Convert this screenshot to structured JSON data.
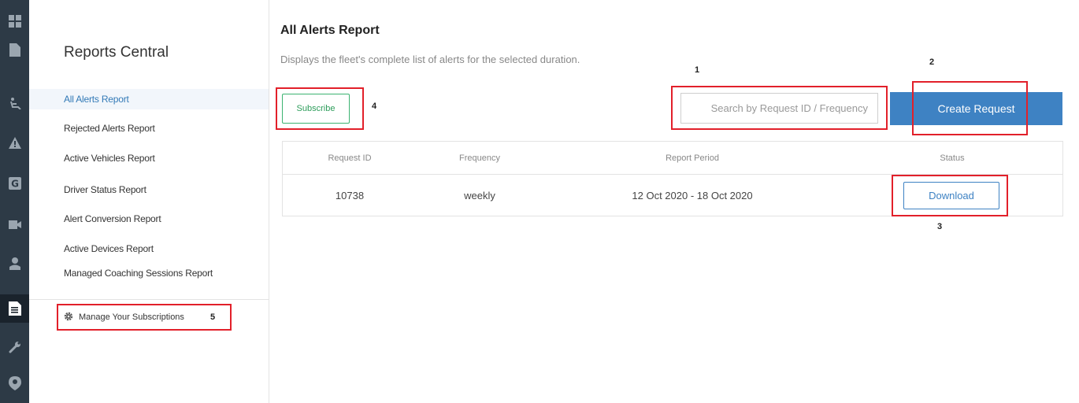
{
  "rail": {
    "icons": [
      "dashboard-icon",
      "document-icon",
      "driver-seat-icon",
      "alert-icon",
      "g-sensor-icon",
      "video-icon",
      "person-icon",
      "reports-icon",
      "wrench-icon",
      "location-shield-icon"
    ],
    "active": "reports-icon"
  },
  "nav": {
    "title": "Reports Central",
    "items": [
      {
        "label": "All Alerts Report",
        "active": true
      },
      {
        "label": "Rejected Alerts Report"
      },
      {
        "label": "Active Vehicles Report"
      },
      {
        "label": "Driver Status Report"
      },
      {
        "label": "Alert Conversion Report"
      },
      {
        "label": "Active Devices Report"
      },
      {
        "label": "Managed Coaching Sessions Report"
      }
    ],
    "manage_label": "Manage Your Subscriptions",
    "manage_marker": "5"
  },
  "main": {
    "title": "All Alerts Report",
    "subtitle": "Displays the fleet's complete list of alerts for the selected duration.",
    "subscribe_label": "Subscribe",
    "subscribe_marker": "4",
    "search_placeholder": "Search by Request ID / Frequency",
    "search_marker": "1",
    "create_label": "Create Request",
    "create_marker": "2",
    "download_marker": "3"
  },
  "table": {
    "headers": [
      "Request ID",
      "Frequency",
      "Report Period",
      "Status"
    ],
    "rows": [
      {
        "request_id": "10738",
        "frequency": "weekly",
        "period": "12 Oct 2020 - 18 Oct 2020",
        "status_label": "Download"
      }
    ]
  },
  "colors": {
    "rail_bg": "#2d3a46",
    "accent_blue": "#3e82c3",
    "subscribe_green": "#3cb371",
    "highlight_red": "#e2202a"
  }
}
